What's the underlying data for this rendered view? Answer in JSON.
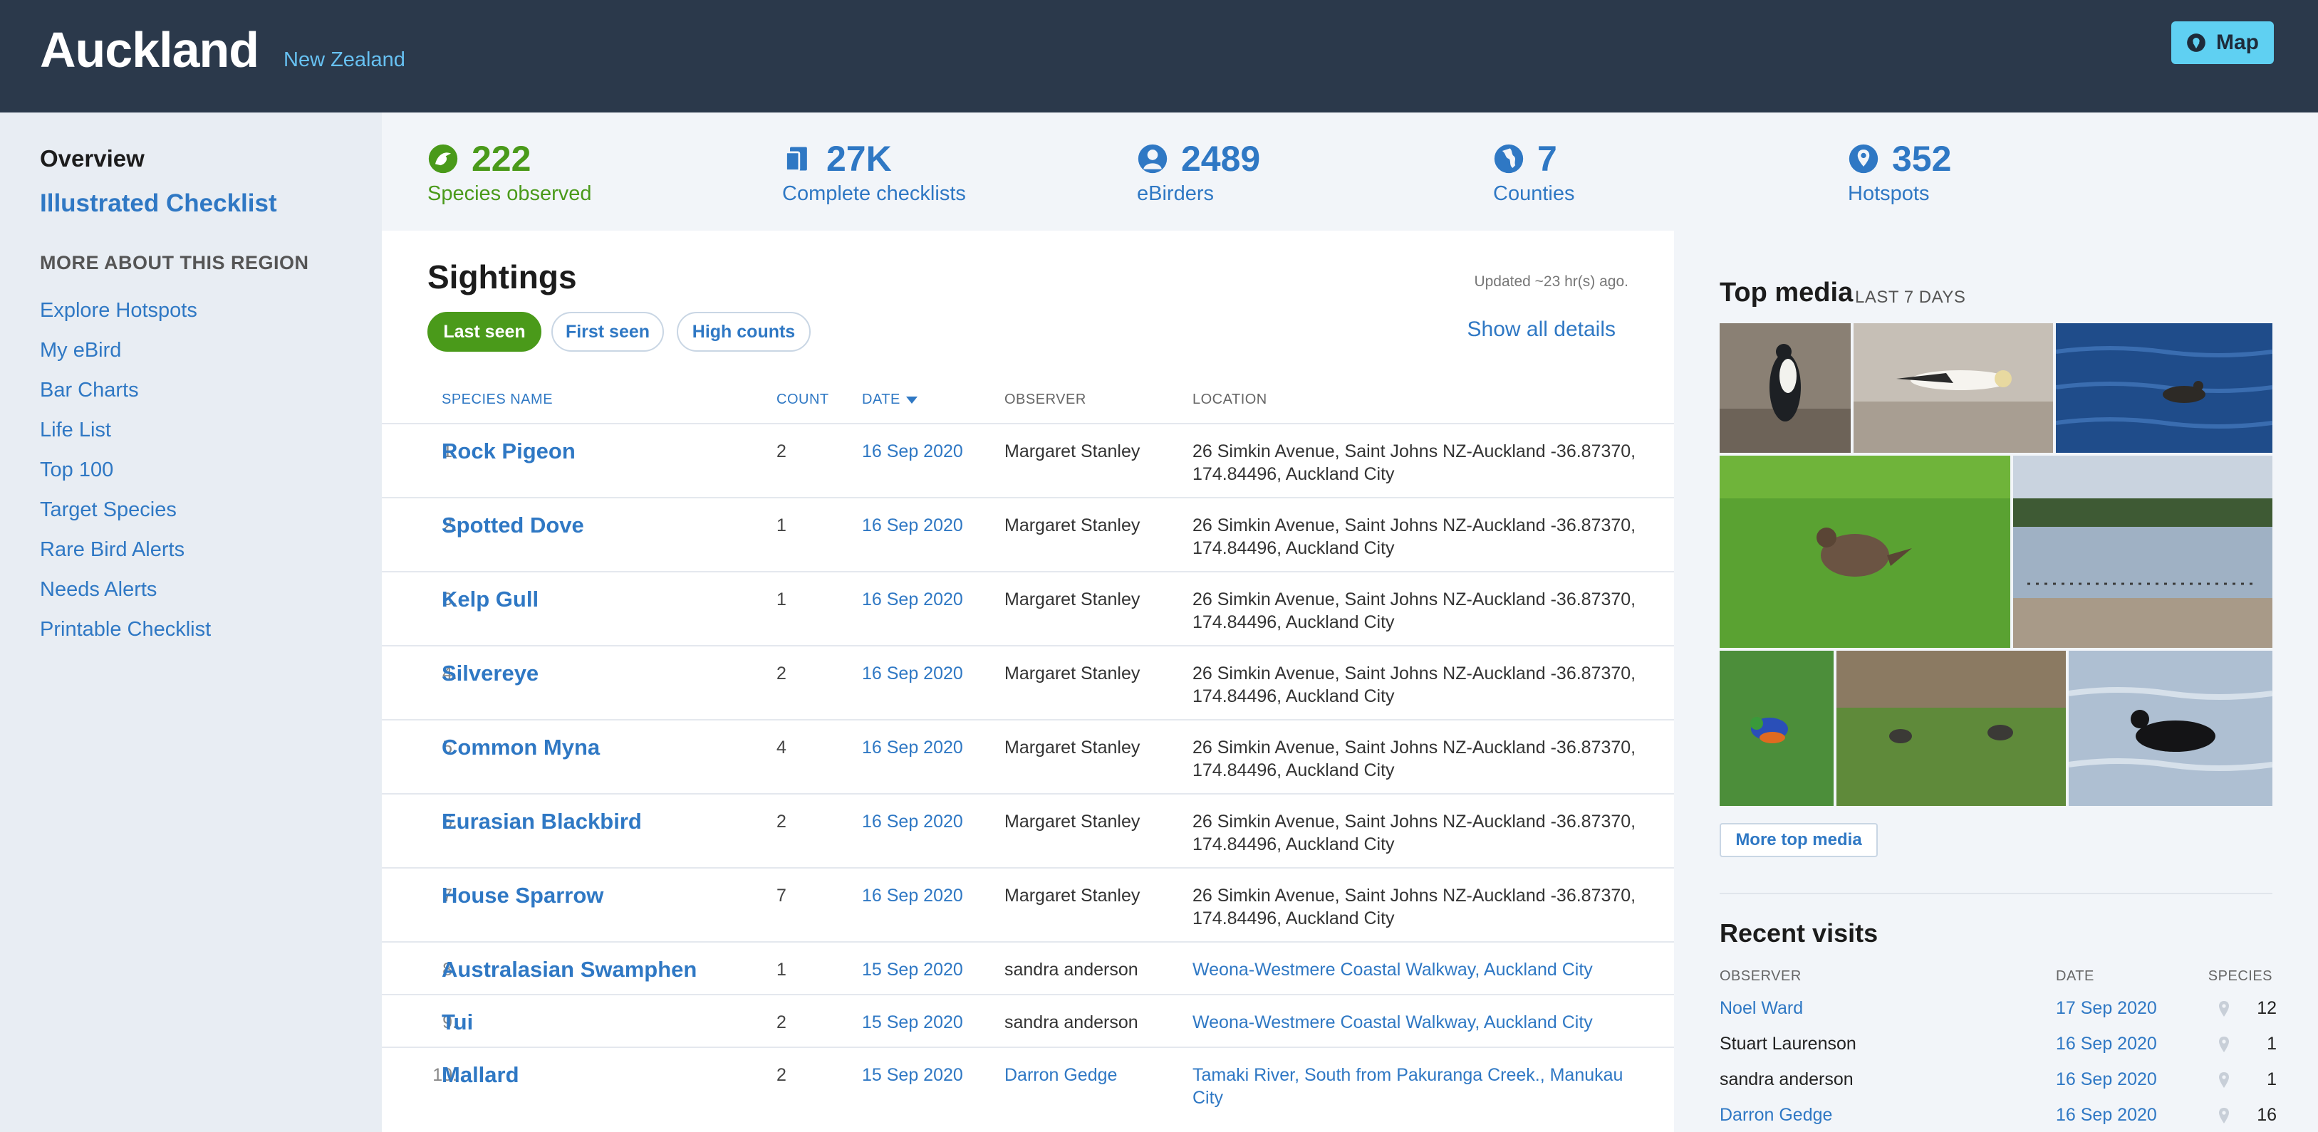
{
  "header": {
    "title": "Auckland",
    "country": "New Zealand",
    "map_label": "Map"
  },
  "sidebar": {
    "overview": "Overview",
    "checklist": "Illustrated Checklist",
    "more_heading": "MORE ABOUT THIS REGION",
    "links": [
      "Explore Hotspots",
      "My eBird",
      "Bar Charts",
      "Life List",
      "Top 100",
      "Target Species",
      "Rare Bird Alerts",
      "Needs Alerts",
      "Printable Checklist"
    ]
  },
  "stats": [
    {
      "value": "222",
      "label": "Species observed",
      "icon": "bird-icon"
    },
    {
      "value": "27K",
      "label": "Complete checklists",
      "icon": "checklist-icon"
    },
    {
      "value": "2489",
      "label": "eBirders",
      "icon": "person-icon"
    },
    {
      "value": "7",
      "label": "Counties",
      "icon": "globe-icon"
    },
    {
      "value": "352",
      "label": "Hotspots",
      "icon": "location-pin-icon"
    }
  ],
  "sightings": {
    "title": "Sightings",
    "updated": "Updated ~23 hr(s) ago.",
    "filters": [
      "Last seen",
      "First seen",
      "High counts"
    ],
    "active_filter": "Last seen",
    "show_all": "Show all details",
    "columns": {
      "species": "SPECIES NAME",
      "count": "COUNT",
      "date": "DATE",
      "observer": "OBSERVER",
      "location": "LOCATION"
    },
    "rows": [
      {
        "num": "1.",
        "species": "Rock Pigeon",
        "count": "2",
        "date": "16 Sep 2020",
        "observer": "Margaret Stanley",
        "location": "26 Simkin Avenue, Saint Johns NZ-Auckland -36.87370, 174.84496, Auckland City"
      },
      {
        "num": "2.",
        "species": "Spotted Dove",
        "count": "1",
        "date": "16 Sep 2020",
        "observer": "Margaret Stanley",
        "location": "26 Simkin Avenue, Saint Johns NZ-Auckland -36.87370, 174.84496, Auckland City"
      },
      {
        "num": "3.",
        "species": "Kelp Gull",
        "count": "1",
        "date": "16 Sep 2020",
        "observer": "Margaret Stanley",
        "location": "26 Simkin Avenue, Saint Johns NZ-Auckland -36.87370, 174.84496, Auckland City"
      },
      {
        "num": "4.",
        "species": "Silvereye",
        "count": "2",
        "date": "16 Sep 2020",
        "observer": "Margaret Stanley",
        "location": "26 Simkin Avenue, Saint Johns NZ-Auckland -36.87370, 174.84496, Auckland City"
      },
      {
        "num": "5.",
        "species": "Common Myna",
        "count": "4",
        "date": "16 Sep 2020",
        "observer": "Margaret Stanley",
        "location": "26 Simkin Avenue, Saint Johns NZ-Auckland -36.87370, 174.84496, Auckland City"
      },
      {
        "num": "6.",
        "species": "Eurasian Blackbird",
        "count": "2",
        "date": "16 Sep 2020",
        "observer": "Margaret Stanley",
        "location": "26 Simkin Avenue, Saint Johns NZ-Auckland -36.87370, 174.84496, Auckland City"
      },
      {
        "num": "7.",
        "species": "House Sparrow",
        "count": "7",
        "date": "16 Sep 2020",
        "observer": "Margaret Stanley",
        "location": "26 Simkin Avenue, Saint Johns NZ-Auckland -36.87370, 174.84496, Auckland City"
      },
      {
        "num": "8.",
        "species": "Australasian Swamphen",
        "count": "1",
        "date": "15 Sep 2020",
        "observer": "sandra anderson",
        "location": "Weona-Westmere Coastal Walkway, Auckland City"
      },
      {
        "num": "9.",
        "species": "Tui",
        "count": "2",
        "date": "15 Sep 2020",
        "observer": "sandra anderson",
        "location": "Weona-Westmere Coastal Walkway, Auckland City"
      },
      {
        "num": "10.",
        "species": "Mallard",
        "count": "2",
        "date": "15 Sep 2020",
        "observer": "Darron Gedge",
        "location": "Tamaki River, South from Pakuranga Creek., Manukau City"
      }
    ]
  },
  "media": {
    "title": "Top media",
    "subtitle": "LAST 7 DAYS",
    "more_label": "More top media"
  },
  "visits": {
    "title": "Recent visits",
    "columns": {
      "observer": "OBSERVER",
      "date": "DATE",
      "species": "SPECIES"
    },
    "rows": [
      {
        "observer": "Noel Ward",
        "date": "17 Sep 2020",
        "species": "12"
      },
      {
        "observer": "Stuart Laurenson",
        "date": "16 Sep 2020",
        "species": "1"
      },
      {
        "observer": "sandra anderson",
        "date": "16 Sep 2020",
        "species": "1"
      },
      {
        "observer": "Darron Gedge",
        "date": "16 Sep 2020",
        "species": "16"
      }
    ]
  },
  "colors": {
    "header_bg": "#2b394b",
    "link_blue": "#2f78c4",
    "active_green": "#4a9a1a",
    "map_button": "#5fd0f2"
  }
}
